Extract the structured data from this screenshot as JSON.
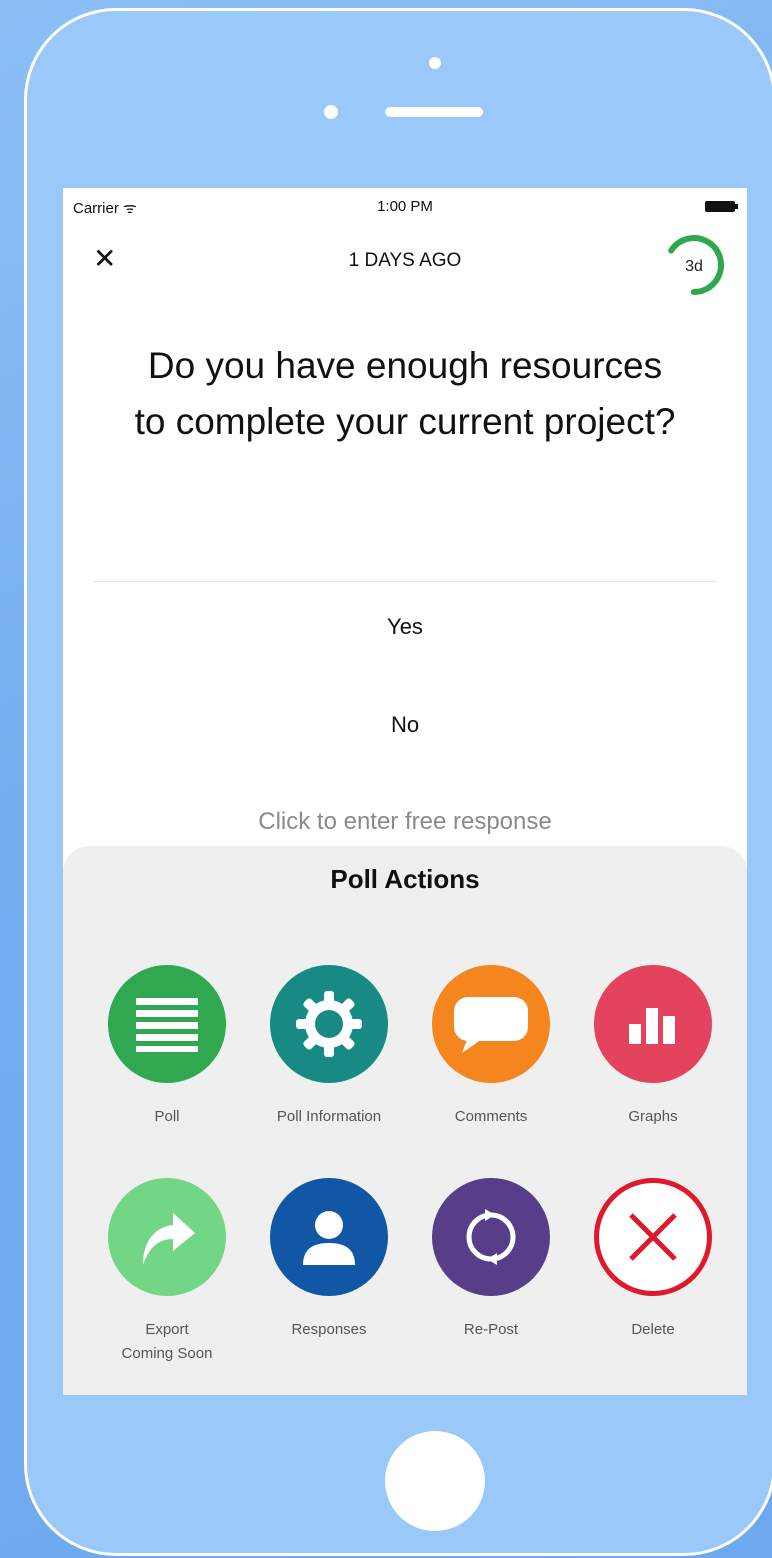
{
  "status_bar": {
    "carrier": "Carrier ᯤ",
    "time": "1:00 PM"
  },
  "header": {
    "days_ago": "1 DAYS AGO",
    "timer_label": "3d",
    "timer_fraction": 0.66
  },
  "question": "Do you have enough resources to complete your current project?",
  "options": [
    "Yes",
    "No"
  ],
  "free_response_placeholder": "Click to enter free response",
  "sheet": {
    "title": "Poll Actions",
    "actions": [
      {
        "label": "Poll",
        "icon": "list-icon",
        "color": "#2fa84f"
      },
      {
        "label": "Poll Information",
        "icon": "gear-icon",
        "color": "#178a84"
      },
      {
        "label": "Comments",
        "icon": "speech-bubble-icon",
        "color": "#f5861f"
      },
      {
        "label": "Graphs",
        "icon": "bar-chart-icon",
        "color": "#e4435e"
      },
      {
        "label": "Export\nComing Soon",
        "icon": "share-arrow-icon",
        "color": "#73d686"
      },
      {
        "label": "Responses",
        "icon": "person-icon",
        "color": "#1157a6"
      },
      {
        "label": "Re-Post",
        "icon": "refresh-icon",
        "color": "#563e88"
      },
      {
        "label": "Delete",
        "icon": "close-circle-icon",
        "color": "#e0182d"
      }
    ]
  },
  "colors": {
    "background": "#79b1f1",
    "timer_green": "#2ea84e"
  }
}
